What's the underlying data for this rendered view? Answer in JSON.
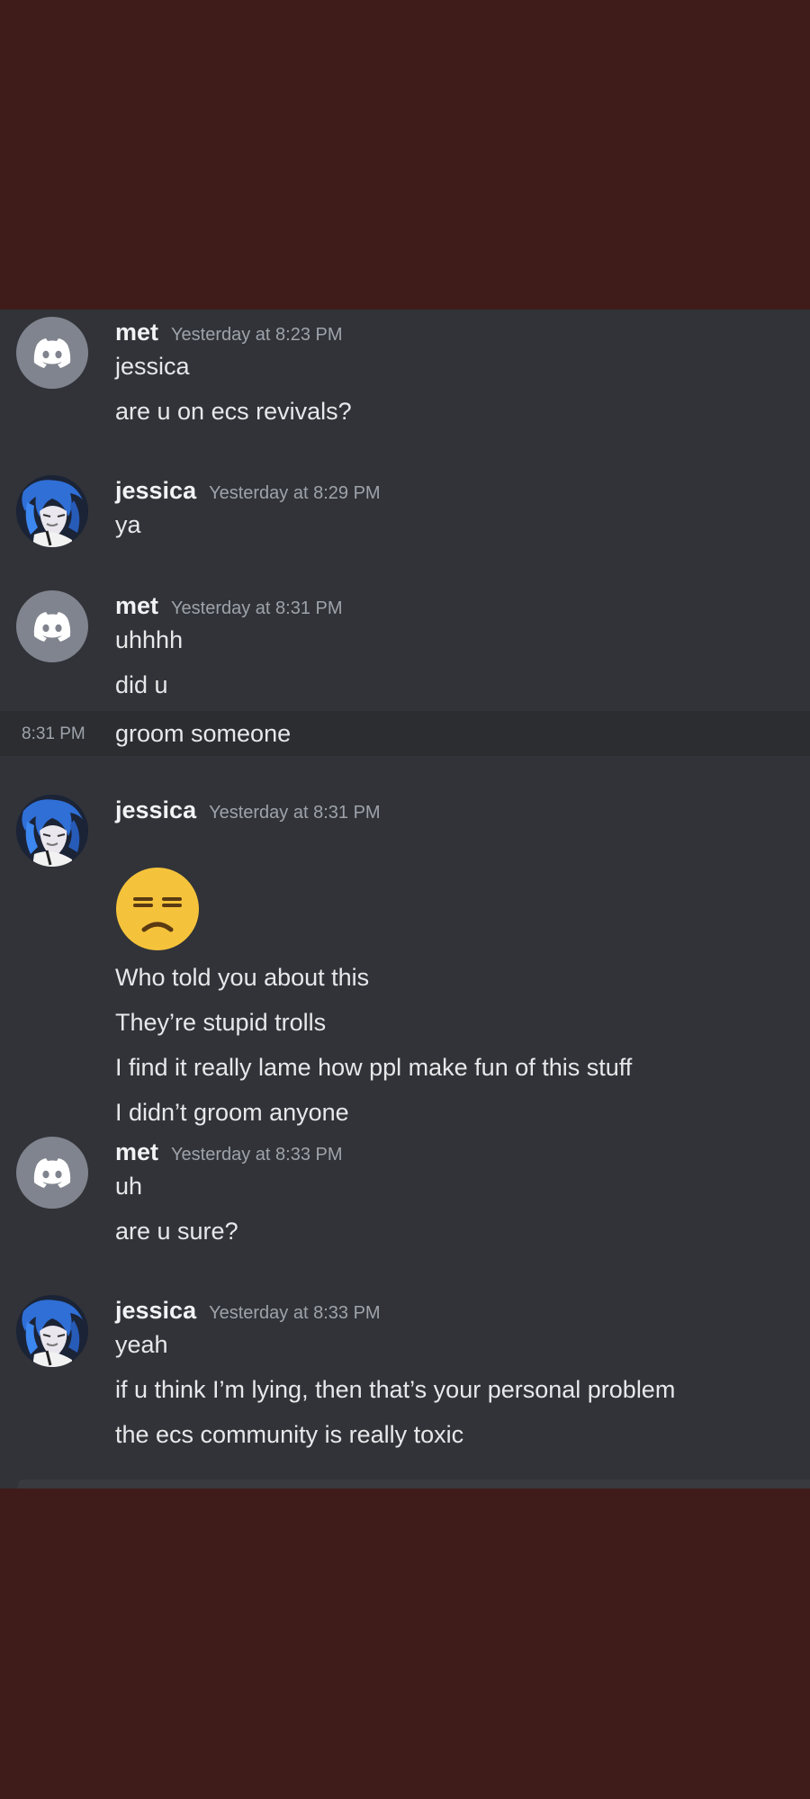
{
  "messages": [
    {
      "author": "met",
      "avatar": "discord-logo-icon",
      "timestamp": "Yesterday at 8:23 PM",
      "lines": [
        "jessica",
        "are u on ecs revivals?"
      ]
    },
    {
      "author": "jessica",
      "avatar": "anime-avatar-icon",
      "timestamp": "Yesterday at 8:29 PM",
      "lines": [
        "ya"
      ]
    },
    {
      "author": "met",
      "avatar": "discord-logo-icon",
      "timestamp": "Yesterday at 8:31 PM",
      "lines": [
        "uhhhh",
        "did u"
      ],
      "hovered_line": {
        "time": "8:31 PM",
        "text": "groom someone"
      }
    },
    {
      "author": "jessica",
      "avatar": "anime-avatar-icon",
      "timestamp": "Yesterday at 8:31 PM",
      "emoji": "unamused-face-emoji",
      "lines": [
        "Who told you about this",
        "They’re stupid trolls",
        "I find it really lame how ppl make fun of this stuff",
        "I didn’t groom anyone"
      ]
    },
    {
      "author": "met",
      "avatar": "discord-logo-icon",
      "timestamp": "Yesterday at 8:33 PM",
      "lines": [
        "uh",
        "are u sure?"
      ]
    },
    {
      "author": "jessica",
      "avatar": "anime-avatar-icon",
      "timestamp": "Yesterday at 8:33 PM",
      "lines": [
        "yeah",
        "if u think I’m lying, then that’s your personal problem",
        "the ecs community is really toxic"
      ]
    }
  ],
  "colors": {
    "page_background": "#3f1c1a",
    "chat_background": "#313338",
    "hover_background": "#2b2d31",
    "username": "#f2f3f5",
    "timestamp": "#9ea3ab",
    "message_text": "#e6e8ea",
    "discord_avatar": "#80848e",
    "emoji_yellow": "#f5c33b"
  }
}
